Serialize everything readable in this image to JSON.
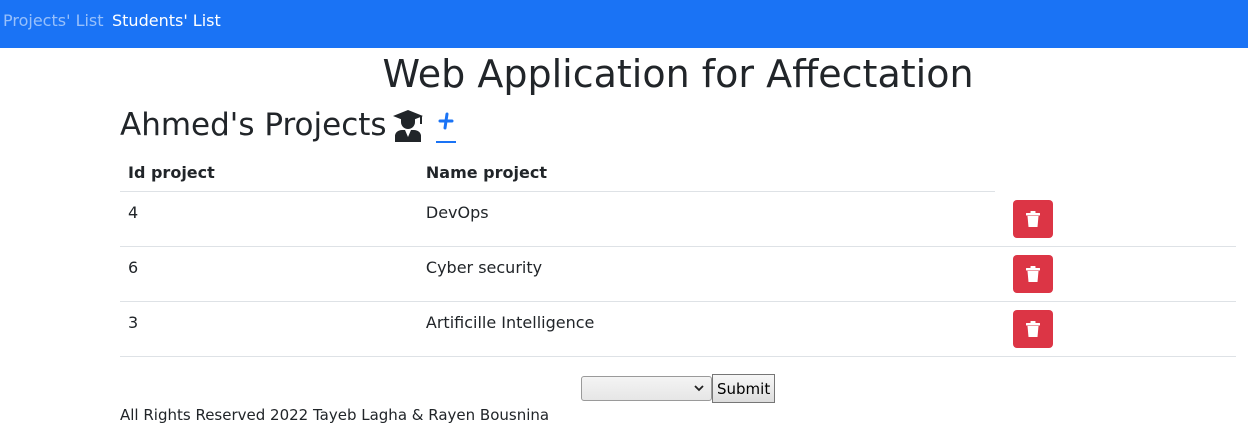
{
  "nav": {
    "projects_list": "Projects' List",
    "students_list": "Students' List"
  },
  "page": {
    "title": "Web Application for Affectation",
    "section_title": "Ahmed's Projects",
    "add_label": "+"
  },
  "table": {
    "headers": {
      "id": "Id project",
      "name": "Name project"
    },
    "rows": [
      {
        "id": "4",
        "name": "DevOps"
      },
      {
        "id": "6",
        "name": "Cyber security"
      },
      {
        "id": "3",
        "name": "Artificille Intelligence"
      }
    ]
  },
  "form": {
    "select_value": "",
    "submit_label": "Submit"
  },
  "footer": {
    "text": "All Rights Reserved 2022 Tayeb Lagha & Rayen Bousnina"
  },
  "colors": {
    "navbar": "#1a73f5",
    "delete": "#dc3545",
    "link": "#1a73f5"
  },
  "icons": {
    "section": "user-graduate-icon",
    "add": "plus-icon",
    "delete": "trash-icon",
    "select": "chevron-down-icon"
  }
}
